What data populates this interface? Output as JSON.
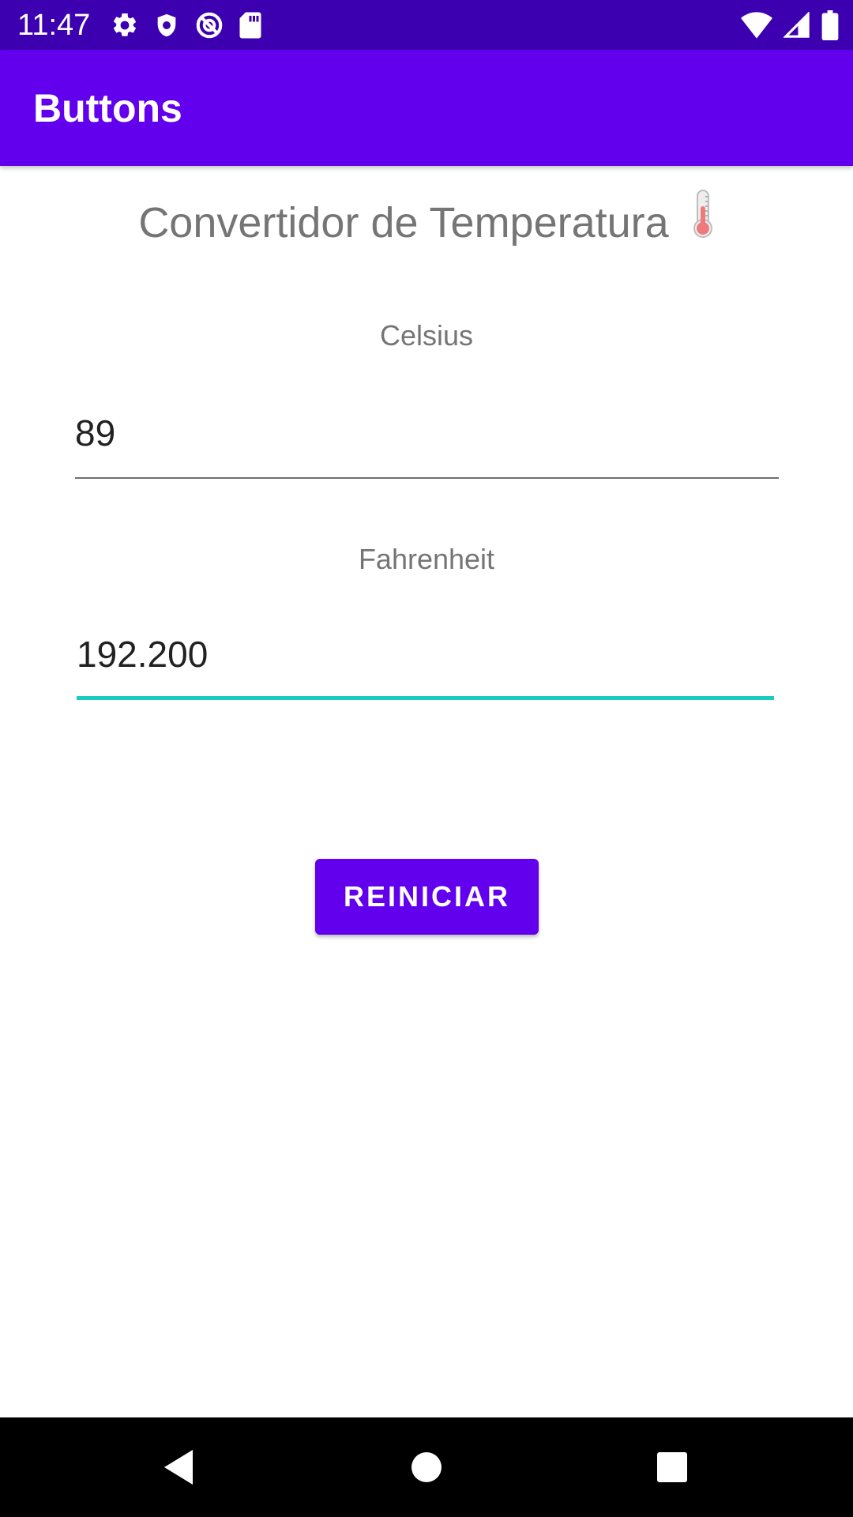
{
  "status_bar": {
    "time": "11:47",
    "background": "#3c00b0",
    "left_icons": [
      "settings-icon",
      "shield-icon",
      "no-sync-icon",
      "sd-card-icon"
    ],
    "right_icons": [
      "wifi-icon",
      "cell-signal-icon",
      "battery-icon"
    ]
  },
  "app_bar": {
    "title": "Buttons",
    "background": "#6200ee"
  },
  "main": {
    "heading": "Convertidor de Temperatura",
    "heading_icon": "thermometer-icon",
    "celsius": {
      "label": "Celsius",
      "value": "89"
    },
    "fahrenheit": {
      "label": "Fahrenheit",
      "value": "192.200",
      "focused": true,
      "focus_color": "#1ccbc0"
    },
    "reset_button": {
      "label": "REINICIAR",
      "background": "#6200ee"
    }
  },
  "nav_bar": {
    "buttons": [
      "back-icon",
      "home-icon",
      "recents-icon"
    ]
  }
}
